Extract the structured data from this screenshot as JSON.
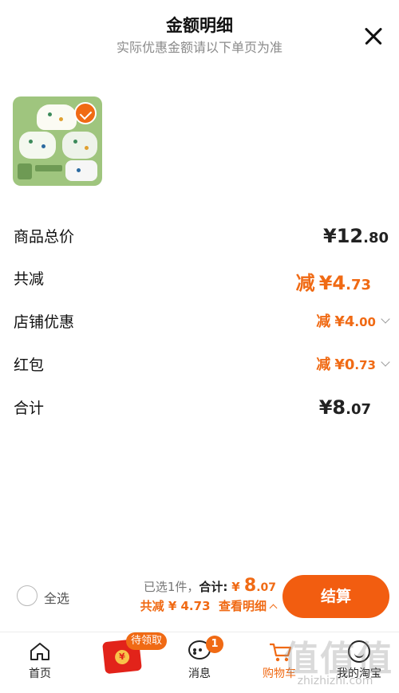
{
  "header": {
    "title": "金额明细",
    "subtitle": "实际优惠金额请以下单页为准"
  },
  "product": {
    "selected": true
  },
  "breakdown": {
    "total": {
      "label": "商品总价",
      "currency": "¥",
      "int": "12",
      "dec": ".80"
    },
    "discount": {
      "label": "共减",
      "prefix": "减",
      "currency": "¥",
      "int": "4",
      "dec": ".73"
    },
    "shop_coupon": {
      "label": "店铺优惠",
      "prefix": "减",
      "currency": "¥",
      "int": "4",
      "dec": ".00"
    },
    "red_packet": {
      "label": "红包",
      "prefix": "减",
      "currency": "¥",
      "int": "0",
      "dec": ".73"
    },
    "sum": {
      "label": "合计",
      "currency": "¥",
      "int": "8",
      "dec": ".07"
    }
  },
  "footer": {
    "select_all": "全选",
    "selected_count": "已选1件，",
    "sum_label": "合计:",
    "sum_currency": "¥",
    "sum_int": "8",
    "sum_dec": ".07",
    "discount_text": "共减 ¥ 4.73",
    "view_detail": "查看明细",
    "checkout": "结算"
  },
  "tabbar": {
    "home": "首页",
    "pending_badge": "待领取",
    "red_packet_coin": "¥",
    "messages": "消息",
    "messages_count": "1",
    "cart": "购物车",
    "mine": "我的淘宝"
  },
  "watermark": {
    "text": "zhizhizhi.com"
  },
  "colors": {
    "accent": "#f06a14",
    "checkout_bg": "#f25d10",
    "muted": "#8a8a8a"
  }
}
